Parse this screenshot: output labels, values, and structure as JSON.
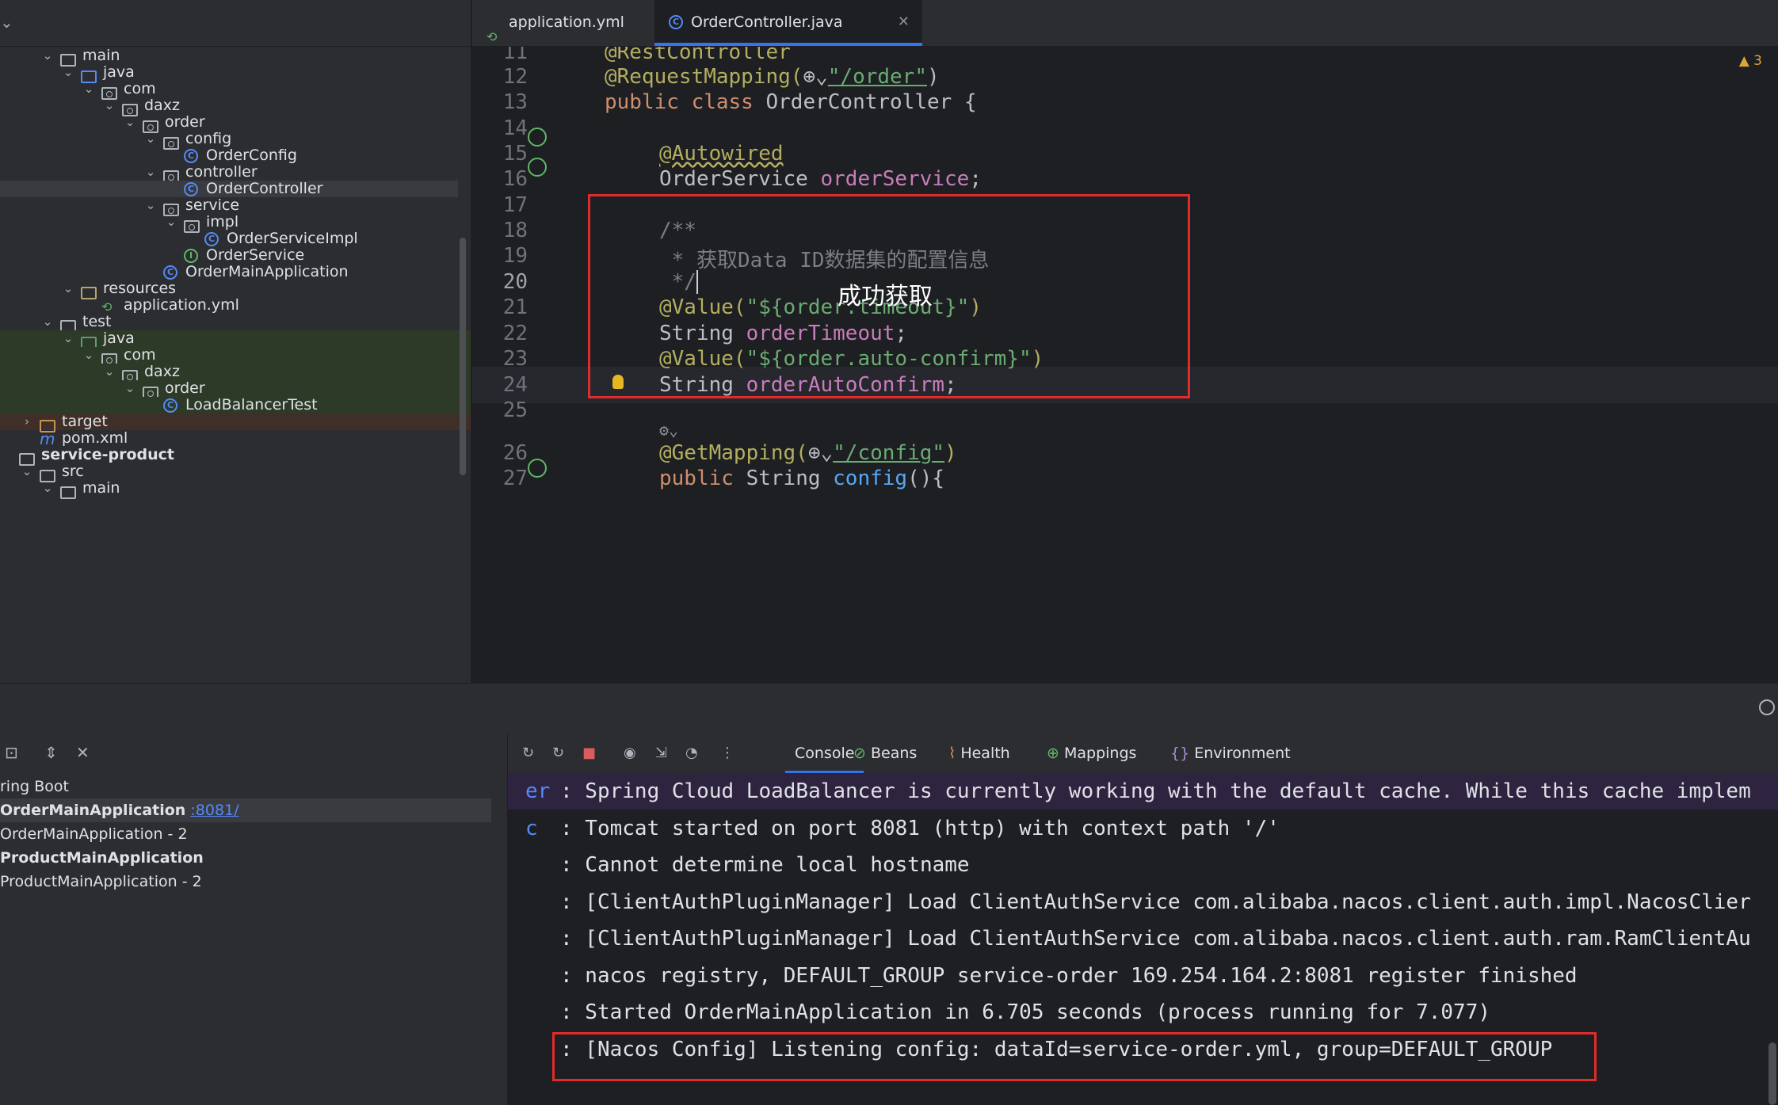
{
  "tabs": [
    {
      "label": "application.yml",
      "icon": "yaml-file-icon",
      "active": false
    },
    {
      "label": "OrderController.java",
      "icon": "java-class-icon",
      "active": true
    }
  ],
  "tree": [
    {
      "label": "main",
      "depth": 1,
      "arrow": "down",
      "icon": "folder"
    },
    {
      "label": "java",
      "depth": 2,
      "arrow": "down",
      "icon": "folder-blue"
    },
    {
      "label": "com",
      "depth": 3,
      "arrow": "down",
      "icon": "package"
    },
    {
      "label": "daxz",
      "depth": 4,
      "arrow": "down",
      "icon": "package"
    },
    {
      "label": "order",
      "depth": 5,
      "arrow": "down",
      "icon": "package"
    },
    {
      "label": "config",
      "depth": 6,
      "arrow": "down",
      "icon": "package"
    },
    {
      "label": "OrderConfig",
      "depth": 7,
      "arrow": "",
      "icon": "class"
    },
    {
      "label": "controller",
      "depth": 6,
      "arrow": "down",
      "icon": "package"
    },
    {
      "label": "OrderController",
      "depth": 7,
      "arrow": "",
      "icon": "class",
      "selected": true
    },
    {
      "label": "service",
      "depth": 6,
      "arrow": "down",
      "icon": "package"
    },
    {
      "label": "impl",
      "depth": 7,
      "arrow": "down",
      "icon": "package"
    },
    {
      "label": "OrderServiceImpl",
      "depth": 8,
      "arrow": "",
      "icon": "class"
    },
    {
      "label": "OrderService",
      "depth": 7,
      "arrow": "",
      "icon": "interface"
    },
    {
      "label": "OrderMainApplication",
      "depth": 6,
      "arrow": "",
      "icon": "class"
    },
    {
      "label": "resources",
      "depth": 2,
      "arrow": "down",
      "icon": "folder-res"
    },
    {
      "label": "application.yml",
      "depth": 3,
      "arrow": "",
      "icon": "yaml"
    },
    {
      "label": "test",
      "depth": 1,
      "arrow": "down",
      "icon": "folder"
    },
    {
      "label": "java",
      "depth": 2,
      "arrow": "down",
      "icon": "folder-green",
      "test": true
    },
    {
      "label": "com",
      "depth": 3,
      "arrow": "down",
      "icon": "package",
      "test": true
    },
    {
      "label": "daxz",
      "depth": 4,
      "arrow": "down",
      "icon": "package",
      "test": true
    },
    {
      "label": "order",
      "depth": 5,
      "arrow": "down",
      "icon": "package",
      "test": true
    },
    {
      "label": "LoadBalancerTest",
      "depth": 6,
      "arrow": "",
      "icon": "class",
      "test": true
    },
    {
      "label": "target",
      "depth": 0,
      "arrow": "right",
      "icon": "folder-orange",
      "excluded": true
    },
    {
      "label": "pom.xml",
      "depth": 0,
      "arrow": "",
      "icon": "maven"
    },
    {
      "label": "service-product",
      "depth": -1,
      "arrow": "",
      "icon": "folder",
      "bold": true
    },
    {
      "label": "src",
      "depth": 0,
      "arrow": "down",
      "icon": "folder"
    },
    {
      "label": "main",
      "depth": 1,
      "arrow": "down",
      "icon": "folder"
    }
  ],
  "editor": {
    "lines": [
      {
        "n": "11",
        "html": "ann:@RestController"
      },
      {
        "n": "12"
      },
      {
        "n": "13"
      },
      {
        "n": "14"
      },
      {
        "n": "15"
      },
      {
        "n": "16"
      },
      {
        "n": "17"
      },
      {
        "n": "18"
      },
      {
        "n": "19"
      },
      {
        "n": "20",
        "current": true
      },
      {
        "n": "21"
      },
      {
        "n": "22"
      },
      {
        "n": "23"
      },
      {
        "n": "24"
      },
      {
        "n": "25"
      },
      {
        "n": "26"
      },
      {
        "n": "27"
      }
    ],
    "code": {
      "l11": "@RestController",
      "l12_a": "@RequestMapping(",
      "l12_b": "\"/order\"",
      "l12_c": ")",
      "l13_a": "public class ",
      "l13_b": "OrderController {",
      "l15": "@Autowired",
      "l16_a": "OrderService ",
      "l16_b": "orderService",
      "l16_c": ";",
      "l18": "/**",
      "l19": " * 获取Data ID数据集的配置信息",
      "l20": " */",
      "l21_a": "@Value(",
      "l21_b": "\"${order.timeout}\"",
      "l21_c": ")",
      "l22_a": "String ",
      "l22_b": "orderTimeout",
      "l22_c": ";",
      "l23_a": "@Value(",
      "l23_b": "\"${order.auto-confirm}\"",
      "l23_c": ")",
      "l24_a": "String ",
      "l24_b": "orderAutoConfirm",
      "l24_c": ";",
      "l26_a": "@GetMapping(",
      "l26_b": "\"/config\"",
      "l26_c": ")",
      "l27_a": "public ",
      "l27_b": "String ",
      "l27_c": "config",
      "l27_d": "(){"
    },
    "warning_count": "3",
    "overlay_note": "成功获取"
  },
  "services": {
    "header": "ring Boot",
    "items": [
      {
        "name": "OrderMainApplication",
        "bold": true,
        "port": ":8081/",
        "selected": true
      },
      {
        "name": "OrderMainApplication",
        "suffix": " - 2",
        "bold": false
      },
      {
        "name": "ProductMainApplication",
        "bold": true
      },
      {
        "name": "ProductMainApplication",
        "suffix": " - 2",
        "bold": false
      }
    ]
  },
  "console": {
    "tabs": [
      {
        "label": "Console",
        "icon": "",
        "active": true
      },
      {
        "label": "Beans",
        "icon": "beans-icon"
      },
      {
        "label": "Health",
        "icon": "health-icon"
      },
      {
        "label": "Mappings",
        "icon": "mappings-icon"
      },
      {
        "label": "Environment",
        "icon": "environment-icon"
      }
    ],
    "lines": [
      {
        "prefix": "er",
        "text": ": Spring Cloud LoadBalancer is currently working with the default cache. While this cache implem",
        "highlight": true
      },
      {
        "prefix": "c",
        "text": ": Tomcat started on port 8081 (http) with context path '/'"
      },
      {
        "prefix": "",
        "text": ": Cannot determine local hostname"
      },
      {
        "prefix": "",
        "text": ": [ClientAuthPluginManager] Load ClientAuthService com.alibaba.nacos.client.auth.impl.NacosClier"
      },
      {
        "prefix": "",
        "text": ": [ClientAuthPluginManager] Load ClientAuthService com.alibaba.nacos.client.auth.ram.RamClientAu"
      },
      {
        "prefix": "",
        "text": ": nacos registry, DEFAULT_GROUP service-order 169.254.164.2:8081 register finished"
      },
      {
        "prefix": "",
        "text": ": Started OrderMainApplication in 6.705 seconds (process running for 7.077)"
      },
      {
        "prefix": "",
        "text": ": [Nacos Config] Listening config: dataId=service-order.yml, group=DEFAULT_GROUP"
      }
    ]
  }
}
